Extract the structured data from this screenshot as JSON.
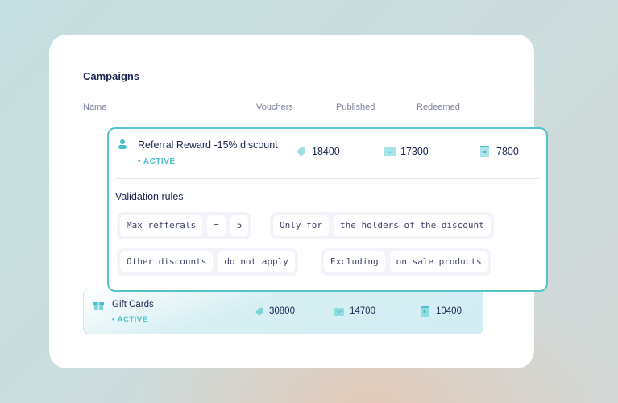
{
  "title": "Campaigns",
  "columns": [
    "Name",
    "Vouchers",
    "Published",
    "Redeemed"
  ],
  "campaigns": [
    {
      "name": "Referral Reward -15% discount",
      "status": "ACTIVE",
      "icon": "user-icon",
      "vouchers": "18400",
      "published": "17300",
      "redeemed": "7800"
    },
    {
      "name": "Gift Cards",
      "status": "ACTIVE",
      "icon": "gift-icon",
      "vouchers": "30800",
      "published": "14700",
      "redeemed": "10400"
    }
  ],
  "validation": {
    "title": "Validation rules",
    "rules": [
      [
        "Max refferals",
        "=",
        "5"
      ],
      [
        "Only for",
        "the holders of the discount"
      ],
      [
        "Other discounts",
        "do not apply"
      ],
      [
        "Excluding",
        "on sale products"
      ]
    ]
  },
  "colors": {
    "accent": "#55c3c9",
    "text": "#1b2452"
  }
}
